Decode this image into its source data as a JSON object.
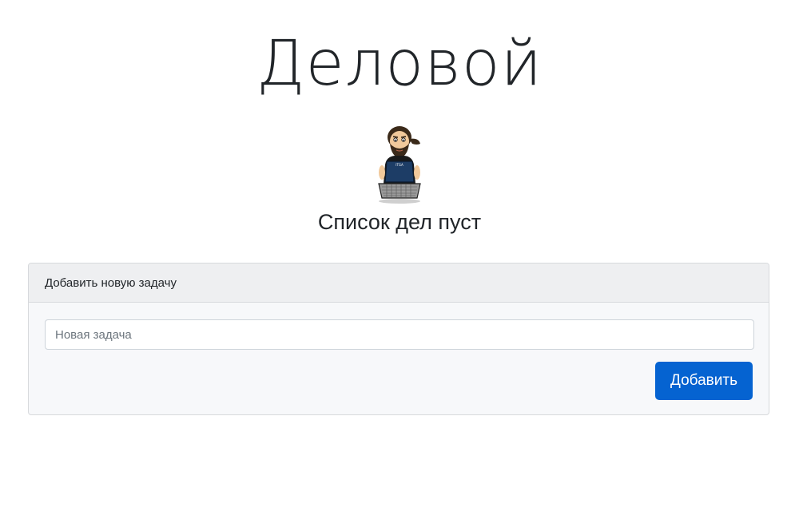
{
  "header": {
    "title": "Деловой"
  },
  "mascot": {
    "icon": "programmer-mascot-icon"
  },
  "todo": {
    "empty_message": "Список дел пуст"
  },
  "add_task_card": {
    "header_label": "Добавить новую задачу",
    "input_placeholder": "Новая задача",
    "input_value": "",
    "button_label": "Добавить"
  },
  "colors": {
    "accent": "#0563d1",
    "card_background": "#f7f8fa",
    "card_header_background": "#eeeff1"
  }
}
